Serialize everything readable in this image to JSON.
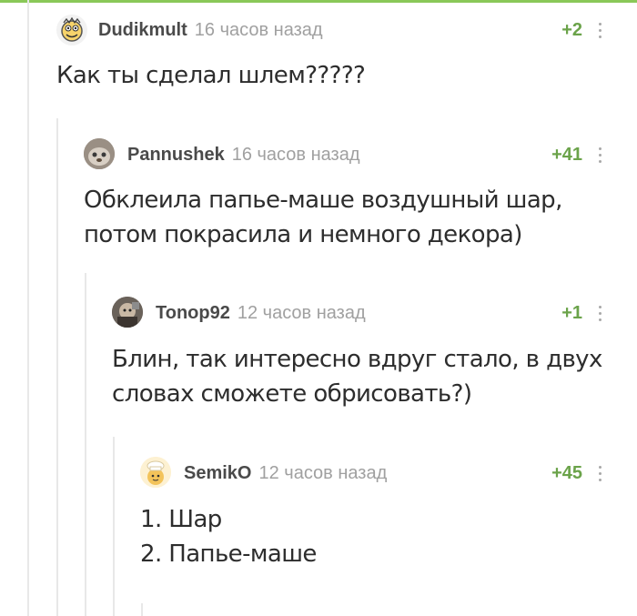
{
  "colors": {
    "accent": "#8ac858",
    "rating": "#6ba34a",
    "muted": "#a0a0a0"
  },
  "comments": [
    {
      "user": "Dudikmult",
      "time": "16 часов назад",
      "rating": "+2",
      "avatar_icon": "cartoon-face-avatar-icon",
      "lines": [
        "Как ты сделал шлем?????"
      ]
    },
    {
      "user": "Pannushek",
      "time": "16 часов назад",
      "rating": "+41",
      "avatar_icon": "photo-avatar-icon",
      "lines": [
        "Обклеила папье-маше воздушный шар,",
        "потом покрасила и немного декора)"
      ]
    },
    {
      "user": "Tonop92",
      "time": "12 часов назад",
      "rating": "+1",
      "avatar_icon": "photo-avatar-icon",
      "lines": [
        "Блин, так интересно вдруг стало, в двух",
        "словах сможете обрисовать?)"
      ]
    },
    {
      "user": "SemikO",
      "time": "12 часов назад",
      "rating": "+45",
      "avatar_icon": "chef-avatar-icon",
      "lines": [
        "1. Шар",
        "2. Папье-маше"
      ]
    }
  ]
}
